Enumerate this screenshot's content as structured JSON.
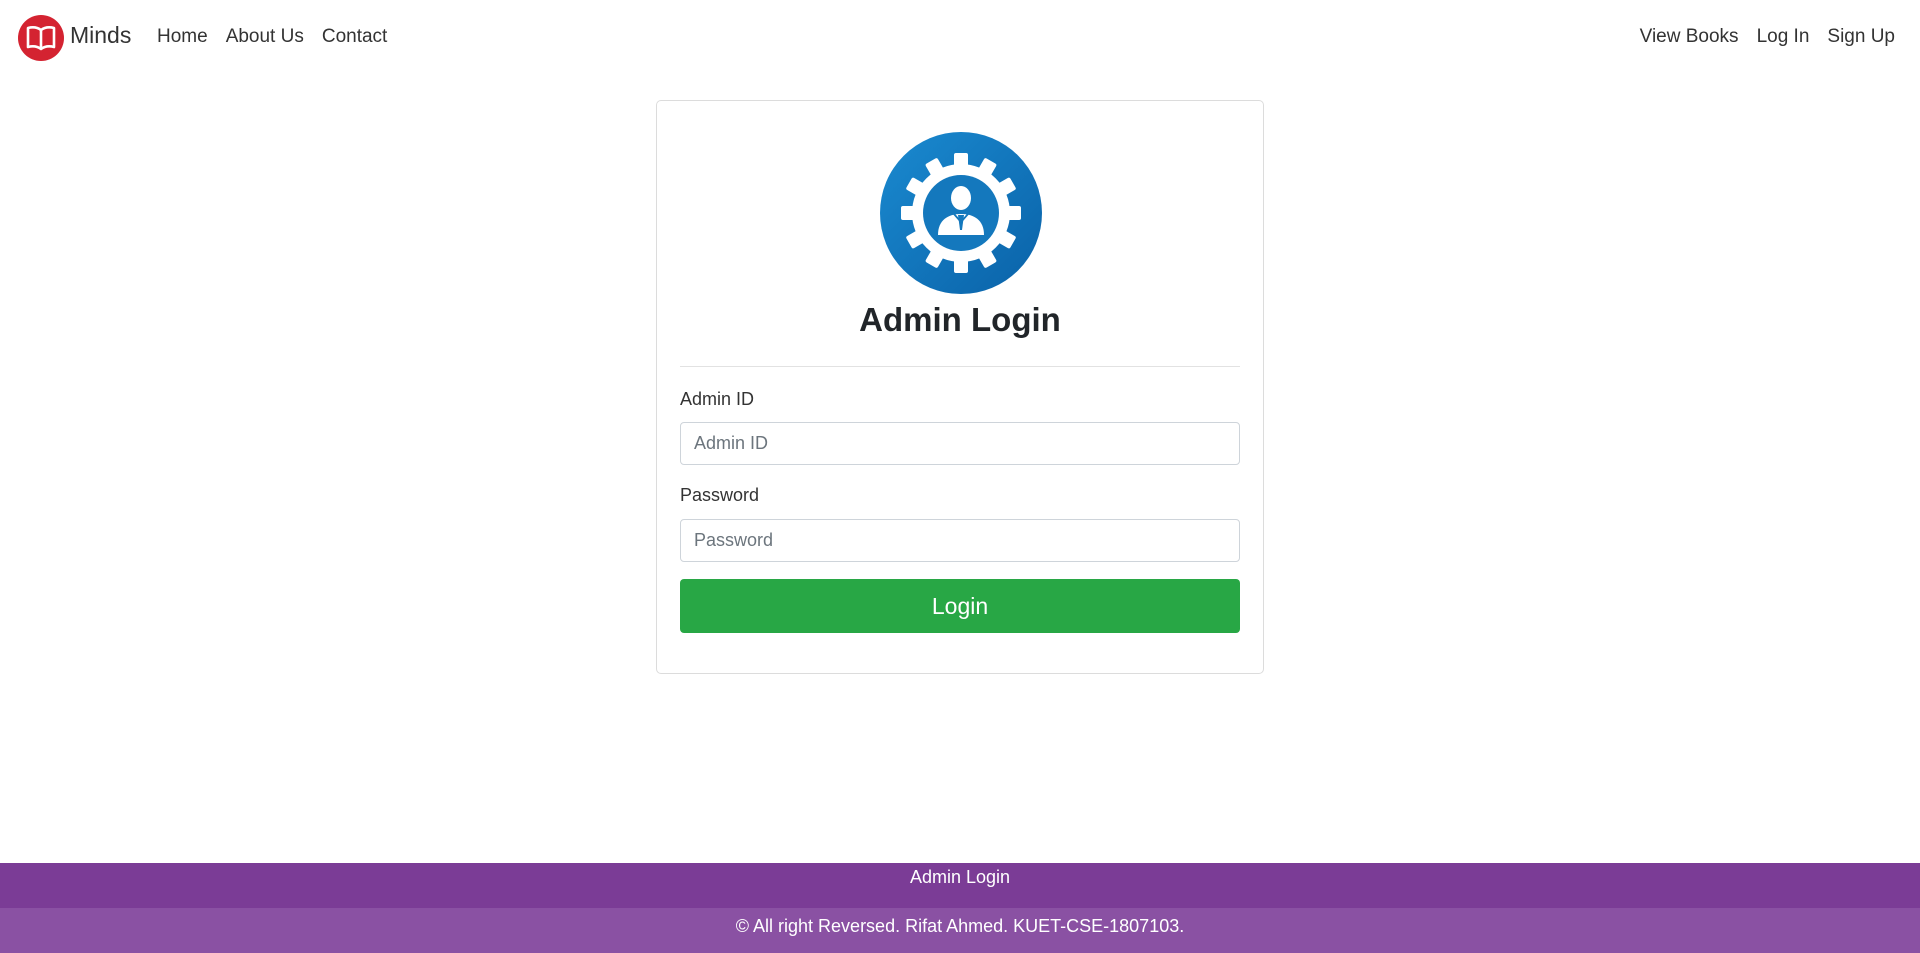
{
  "navbar": {
    "brand_name": "Minds",
    "brand_icon": "open-book-icon",
    "left_links": [
      "Home",
      "About Us",
      "Contact"
    ],
    "right_links": [
      "View Books",
      "Log In",
      "Sign Up"
    ],
    "brand_color": "#d42331"
  },
  "card": {
    "icon": "admin-gear-user-icon",
    "title": "Admin Login",
    "fields": [
      {
        "label": "Admin ID",
        "placeholder": "Admin ID",
        "value": ""
      },
      {
        "label": "Password",
        "placeholder": "Password",
        "value": ""
      }
    ],
    "submit_label": "Login",
    "submit_color": "#28a745"
  },
  "footer": {
    "top_link": "Admin Login",
    "copyright": "© All right Reversed. Rifat Ahmed. KUET-CSE-1807103.",
    "top_color": "#7b3c96",
    "bottom_color": "#8a51a3"
  }
}
